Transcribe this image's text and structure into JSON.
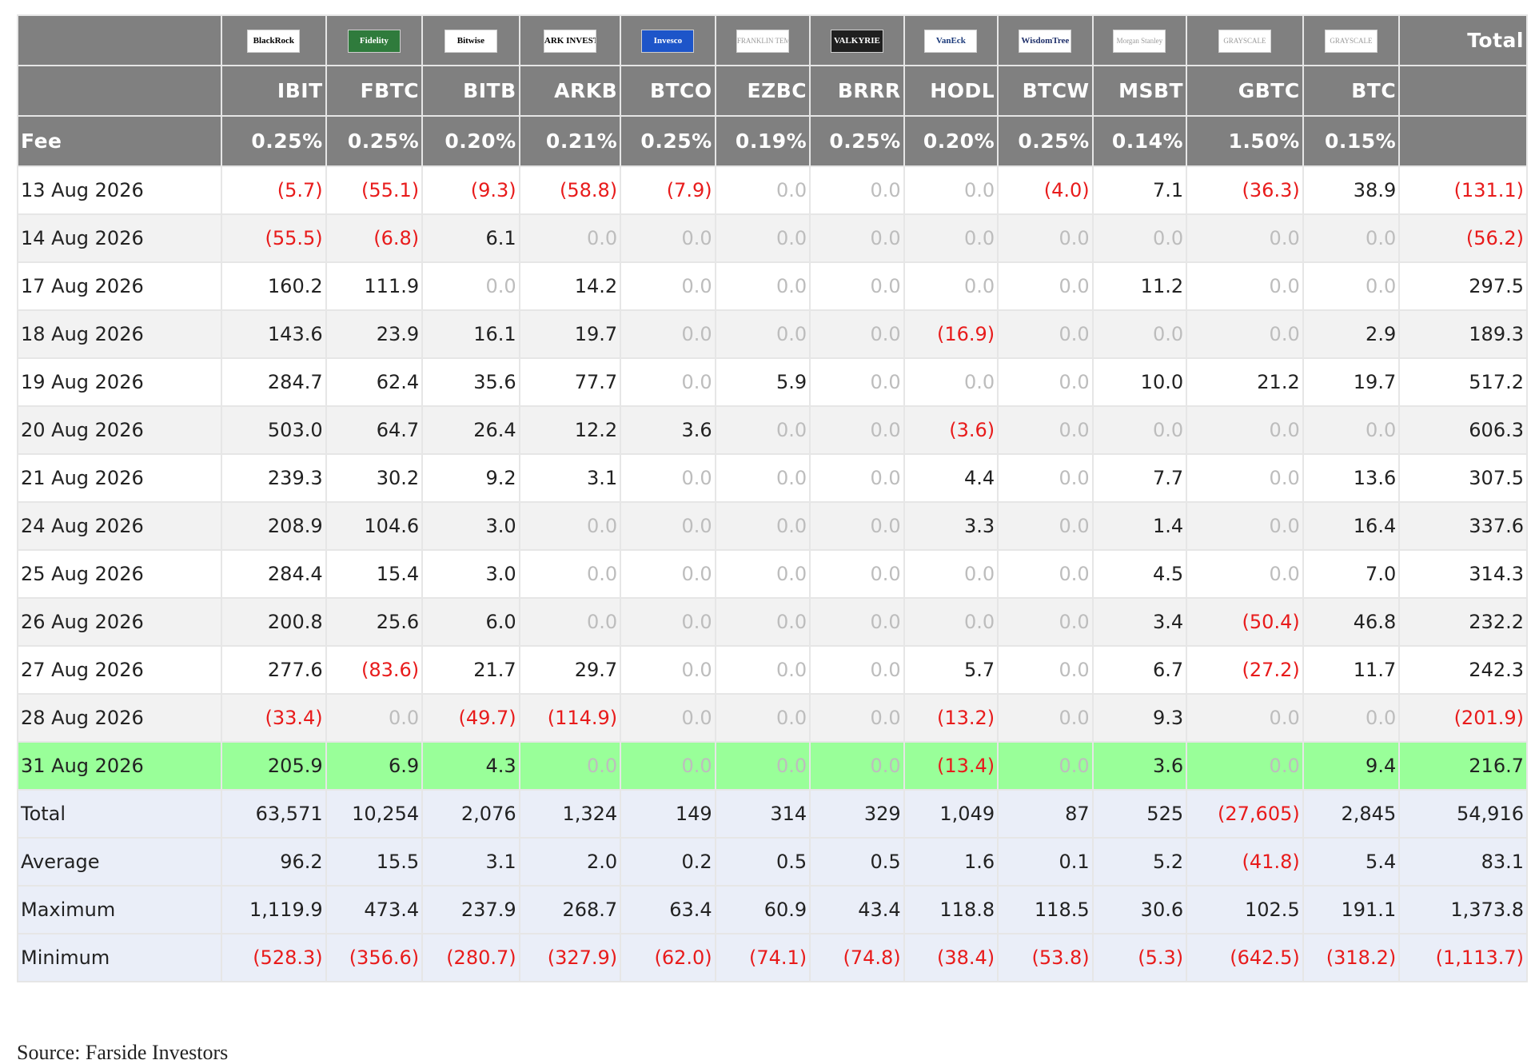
{
  "source": "Source: Farside Investors",
  "header": {
    "total_label": "Total",
    "fee_label": "Fee",
    "funds": [
      {
        "issuer": "BlackRock",
        "logo_text": "BlackRock",
        "logo_icon": "blackrock-logo",
        "ticker": "IBIT",
        "fee": "0.25%"
      },
      {
        "issuer": "Fidelity",
        "logo_text": "Fidelity",
        "logo_icon": "fidelity-logo",
        "ticker": "FBTC",
        "fee": "0.25%"
      },
      {
        "issuer": "Bitwise",
        "logo_text": "Bitwise",
        "logo_icon": "bitwise-logo",
        "ticker": "BITB",
        "fee": "0.20%"
      },
      {
        "issuer": "ARK Invest",
        "logo_text": "ARK INVEST",
        "logo_icon": "ark-invest-logo",
        "ticker": "ARKB",
        "fee": "0.21%"
      },
      {
        "issuer": "Invesco",
        "logo_text": "Invesco",
        "logo_icon": "invesco-logo",
        "ticker": "BTCO",
        "fee": "0.25%"
      },
      {
        "issuer": "Franklin Templeton",
        "logo_text": "FRANKLIN TEMPLETON",
        "logo_icon": "franklin-templeton-logo",
        "ticker": "EZBC",
        "fee": "0.19%"
      },
      {
        "issuer": "Valkyrie",
        "logo_text": "VALKYRIE",
        "logo_icon": "valkyrie-logo",
        "ticker": "BRRR",
        "fee": "0.25%"
      },
      {
        "issuer": "VanEck",
        "logo_text": "VanEck",
        "logo_icon": "vaneck-logo",
        "ticker": "HODL",
        "fee": "0.20%"
      },
      {
        "issuer": "WisdomTree",
        "logo_text": "WisdomTree",
        "logo_icon": "wisdomtree-logo",
        "ticker": "BTCW",
        "fee": "0.25%"
      },
      {
        "issuer": "Morgan Stanley",
        "logo_text": "Morgan Stanley",
        "logo_icon": "morgan-stanley-logo",
        "ticker": "MSBT",
        "fee": "0.14%"
      },
      {
        "issuer": "Grayscale",
        "logo_text": "GRAYSCALE",
        "logo_icon": "grayscale-logo",
        "ticker": "GBTC",
        "fee": "1.50%"
      },
      {
        "issuer": "Grayscale",
        "logo_text": "GRAYSCALE",
        "logo_icon": "grayscale-logo",
        "ticker": "BTC",
        "fee": "0.15%"
      }
    ]
  },
  "colors": {
    "header_bg": "#808080",
    "negative": "#e81b1b",
    "zero": "#bdbdbd",
    "highlight_row": "#99ff99",
    "stats_bg": "#eaeef8",
    "stripe": "#f2f2f2"
  },
  "chart_data": {
    "type": "table",
    "title": "",
    "columns": [
      "",
      "IBIT",
      "FBTC",
      "BITB",
      "ARKB",
      "BTCO",
      "EZBC",
      "BRRR",
      "HODL",
      "BTCW",
      "MSBT",
      "GBTC",
      "BTC",
      "Total"
    ],
    "rows": [
      {
        "label": "13 Aug 2026",
        "cells": [
          "(5.7)",
          "(55.1)",
          "(9.3)",
          "(58.8)",
          "(7.9)",
          "0.0",
          "0.0",
          "0.0",
          "(4.0)",
          "7.1",
          "(36.3)",
          "38.9",
          "(131.1)"
        ]
      },
      {
        "label": "14 Aug 2026",
        "cells": [
          "(55.5)",
          "(6.8)",
          "6.1",
          "0.0",
          "0.0",
          "0.0",
          "0.0",
          "0.0",
          "0.0",
          "0.0",
          "0.0",
          "0.0",
          "(56.2)"
        ]
      },
      {
        "label": "17 Aug 2026",
        "cells": [
          "160.2",
          "111.9",
          "0.0",
          "14.2",
          "0.0",
          "0.0",
          "0.0",
          "0.0",
          "0.0",
          "11.2",
          "0.0",
          "0.0",
          "297.5"
        ]
      },
      {
        "label": "18 Aug 2026",
        "cells": [
          "143.6",
          "23.9",
          "16.1",
          "19.7",
          "0.0",
          "0.0",
          "0.0",
          "(16.9)",
          "0.0",
          "0.0",
          "0.0",
          "2.9",
          "189.3"
        ]
      },
      {
        "label": "19 Aug 2026",
        "cells": [
          "284.7",
          "62.4",
          "35.6",
          "77.7",
          "0.0",
          "5.9",
          "0.0",
          "0.0",
          "0.0",
          "10.0",
          "21.2",
          "19.7",
          "517.2"
        ]
      },
      {
        "label": "20 Aug 2026",
        "cells": [
          "503.0",
          "64.7",
          "26.4",
          "12.2",
          "3.6",
          "0.0",
          "0.0",
          "(3.6)",
          "0.0",
          "0.0",
          "0.0",
          "0.0",
          "606.3"
        ]
      },
      {
        "label": "21 Aug 2026",
        "cells": [
          "239.3",
          "30.2",
          "9.2",
          "3.1",
          "0.0",
          "0.0",
          "0.0",
          "4.4",
          "0.0",
          "7.7",
          "0.0",
          "13.6",
          "307.5"
        ]
      },
      {
        "label": "24 Aug 2026",
        "cells": [
          "208.9",
          "104.6",
          "3.0",
          "0.0",
          "0.0",
          "0.0",
          "0.0",
          "3.3",
          "0.0",
          "1.4",
          "0.0",
          "16.4",
          "337.6"
        ]
      },
      {
        "label": "25 Aug 2026",
        "cells": [
          "284.4",
          "15.4",
          "3.0",
          "0.0",
          "0.0",
          "0.0",
          "0.0",
          "0.0",
          "0.0",
          "4.5",
          "0.0",
          "7.0",
          "314.3"
        ]
      },
      {
        "label": "26 Aug 2026",
        "cells": [
          "200.8",
          "25.6",
          "6.0",
          "0.0",
          "0.0",
          "0.0",
          "0.0",
          "0.0",
          "0.0",
          "3.4",
          "(50.4)",
          "46.8",
          "232.2"
        ]
      },
      {
        "label": "27 Aug 2026",
        "cells": [
          "277.6",
          "(83.6)",
          "21.7",
          "29.7",
          "0.0",
          "0.0",
          "0.0",
          "5.7",
          "0.0",
          "6.7",
          "(27.2)",
          "11.7",
          "242.3"
        ]
      },
      {
        "label": "28 Aug 2026",
        "cells": [
          "(33.4)",
          "0.0",
          "(49.7)",
          "(114.9)",
          "0.0",
          "0.0",
          "0.0",
          "(13.2)",
          "0.0",
          "9.3",
          "0.0",
          "0.0",
          "(201.9)"
        ]
      },
      {
        "label": "31 Aug 2026",
        "highlight": true,
        "cells": [
          "205.9",
          "6.9",
          "4.3",
          "0.0",
          "0.0",
          "0.0",
          "0.0",
          "(13.4)",
          "0.0",
          "3.6",
          "0.0",
          "9.4",
          "216.7"
        ]
      }
    ],
    "stats": [
      {
        "label": "Total",
        "cells": [
          "63,571",
          "10,254",
          "2,076",
          "1,324",
          "149",
          "314",
          "329",
          "1,049",
          "87",
          "525",
          "(27,605)",
          "2,845",
          "54,916"
        ]
      },
      {
        "label": "Average",
        "cells": [
          "96.2",
          "15.5",
          "3.1",
          "2.0",
          "0.2",
          "0.5",
          "0.5",
          "1.6",
          "0.1",
          "5.2",
          "(41.8)",
          "5.4",
          "83.1"
        ]
      },
      {
        "label": "Maximum",
        "cells": [
          "1,119.9",
          "473.4",
          "237.9",
          "268.7",
          "63.4",
          "60.9",
          "43.4",
          "118.8",
          "118.5",
          "30.6",
          "102.5",
          "191.1",
          "1,373.8"
        ]
      },
      {
        "label": "Minimum",
        "cells": [
          "(528.3)",
          "(356.6)",
          "(280.7)",
          "(327.9)",
          "(62.0)",
          "(74.1)",
          "(74.8)",
          "(38.4)",
          "(53.8)",
          "(5.3)",
          "(642.5)",
          "(318.2)",
          "(1,113.7)"
        ]
      }
    ]
  }
}
